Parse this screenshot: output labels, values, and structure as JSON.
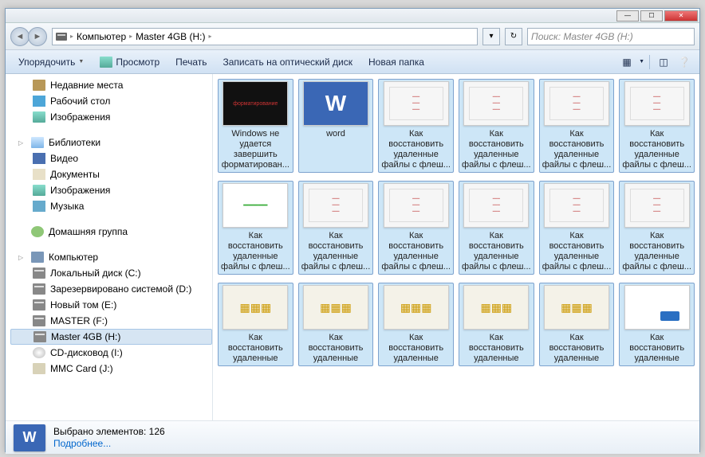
{
  "breadcrumb": {
    "root": "Компьютер",
    "current": "Master 4GB (H:)"
  },
  "search": {
    "placeholder": "Поиск: Master 4GB (H:)"
  },
  "toolbar": {
    "organize": "Упорядочить",
    "preview": "Просмотр",
    "print": "Печать",
    "burn": "Записать на оптический диск",
    "newfolder": "Новая папка"
  },
  "sidebar": {
    "recent": "Недавние места",
    "desktop": "Рабочий стол",
    "images": "Изображения",
    "libraries": "Библиотеки",
    "video": "Видео",
    "documents": "Документы",
    "images2": "Изображения",
    "music": "Музыка",
    "homegroup": "Домашняя группа",
    "computer": "Компьютер",
    "localc": "Локальный диск (C:)",
    "reserved": "Зарезервировано системой (D:)",
    "newvol": "Новый том (E:)",
    "masterf": "MASTER (F:)",
    "masterh": "Master 4GB (H:)",
    "cddrive": "CD-дисковод (I:)",
    "mmc": "MMC Card (J:)"
  },
  "items": [
    {
      "cap": "Windows не удается завершить форматирован...",
      "cls": "usb"
    },
    {
      "cap": "word",
      "cls": "word"
    },
    {
      "cap": "Как восстановить удаленные файлы с флеш...",
      "cls": "win"
    },
    {
      "cap": "Как восстановить удаленные файлы с флеш...",
      "cls": "win"
    },
    {
      "cap": "Как восстановить удаленные файлы с флеш...",
      "cls": "win"
    },
    {
      "cap": "Как восстановить удаленные файлы с флеш...",
      "cls": "win"
    },
    {
      "cap": "Как восстановить удаленные файлы с флеш...",
      "cls": "prog"
    },
    {
      "cap": "Как восстановить удаленные файлы с флеш...",
      "cls": "win"
    },
    {
      "cap": "Как восстановить удаленные файлы с флеш...",
      "cls": "win"
    },
    {
      "cap": "Как восстановить удаленные файлы с флеш...",
      "cls": "win"
    },
    {
      "cap": "Как восстановить удаленные файлы с флеш...",
      "cls": "win"
    },
    {
      "cap": "Как восстановить удаленные файлы с флеш...",
      "cls": "win"
    },
    {
      "cap": "Как восстановить удаленные",
      "cls": "sw"
    },
    {
      "cap": "Как восстановить удаленные",
      "cls": "sw"
    },
    {
      "cap": "Как восстановить удаленные",
      "cls": "sw"
    },
    {
      "cap": "Как восстановить удаленные",
      "cls": "sw"
    },
    {
      "cap": "Как восстановить удаленные",
      "cls": "sw"
    },
    {
      "cap": "Как восстановить удаленные",
      "cls": "usb2"
    }
  ],
  "details": {
    "selected": "Выбрано элементов: 126",
    "more": "Подробнее..."
  }
}
